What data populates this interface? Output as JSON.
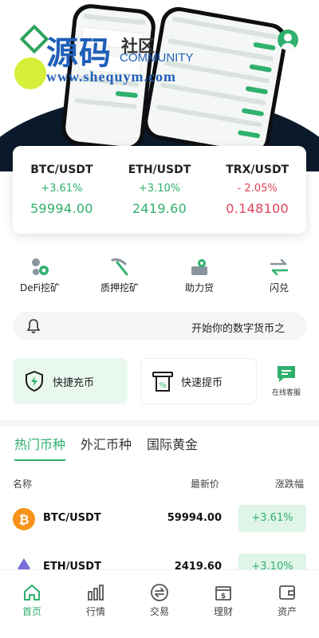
{
  "brand": {
    "logo_main": "源码",
    "logo_sub": "社区",
    "logo_en": "COMMUNITY",
    "logo_url": "www.shequym.com",
    "accent": "#2fb06d"
  },
  "ticker": [
    {
      "pair": "BTC/USDT",
      "change": "+3.61%",
      "price": "59994.00",
      "trend": "up"
    },
    {
      "pair": "ETH/USDT",
      "change": "+3.10%",
      "price": "2419.60",
      "trend": "up"
    },
    {
      "pair": "TRX/USDT",
      "change": "- 2.05%",
      "price": "0.148100",
      "trend": "down"
    }
  ],
  "features": [
    {
      "label": "DeFi挖矿",
      "icon": "defi-mining-icon"
    },
    {
      "label": "质押挖矿",
      "icon": "pickaxe-icon"
    },
    {
      "label": "助力贷",
      "icon": "loan-icon"
    },
    {
      "label": "闪兑",
      "icon": "swap-arrows-icon"
    }
  ],
  "notice": {
    "text": "开始你的数字货币之",
    "icon": "bell-icon"
  },
  "quick_actions": {
    "deposit": "快捷充币",
    "withdraw": "快速提币",
    "support": "在线客服"
  },
  "market": {
    "tabs": [
      "热门币种",
      "外汇币种",
      "国际黄金"
    ],
    "active_tab": 0,
    "columns": {
      "name": "名称",
      "price": "最新价",
      "change": "涨跌幅"
    },
    "rows": [
      {
        "pair": "BTC/USDT",
        "price": "59994.00",
        "change": "+3.61%",
        "coin_icon": "bitcoin-icon"
      },
      {
        "pair": "ETH/USDT",
        "price": "2419.60",
        "change": "+3.10%",
        "coin_icon": "ethereum-icon"
      }
    ]
  },
  "bottom_nav": [
    {
      "label": "首页",
      "icon": "home-icon",
      "active": true
    },
    {
      "label": "行情",
      "icon": "chart-bars-icon",
      "active": false
    },
    {
      "label": "交易",
      "icon": "exchange-icon",
      "active": false
    },
    {
      "label": "理财",
      "icon": "wallet-finance-icon",
      "active": false
    },
    {
      "label": "资产",
      "icon": "assets-icon",
      "active": false
    }
  ]
}
